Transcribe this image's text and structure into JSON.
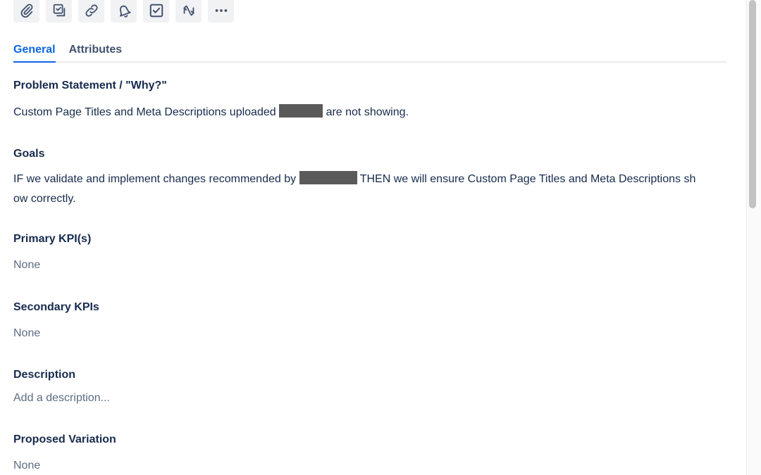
{
  "toolbar": {
    "icons": [
      "paperclip-icon",
      "child-issue-icon",
      "link-icon",
      "bell-icon",
      "checkbox-icon",
      "loop-icon",
      "more-icon"
    ]
  },
  "tabs": [
    {
      "label": "General",
      "active": true
    },
    {
      "label": "Attributes",
      "active": false
    }
  ],
  "sections": {
    "problem": {
      "heading": "Problem Statement / \"Why?\"",
      "text_before": "Custom Page Titles and Meta Descriptions uploaded",
      "text_after": "are not showing."
    },
    "goals": {
      "heading": "Goals",
      "line1_before": "IF we validate and implement changes recommended by",
      "line1_after": "THEN we will ensure Custom Page Titles and Meta Descriptions sh",
      "line2": "ow correctly."
    },
    "primary_kpi": {
      "heading": "Primary KPI(s)",
      "value": "None"
    },
    "secondary_kpi": {
      "heading": "Secondary KPIs",
      "value": "None"
    },
    "description": {
      "heading": "Description",
      "placeholder": "Add a description..."
    },
    "proposed": {
      "heading": "Proposed Variation",
      "value": "None"
    }
  },
  "colors": {
    "accent": "#0c66e4",
    "heading": "#172b4d",
    "muted": "#5e6c84",
    "redaction": "#5a5a5a"
  }
}
